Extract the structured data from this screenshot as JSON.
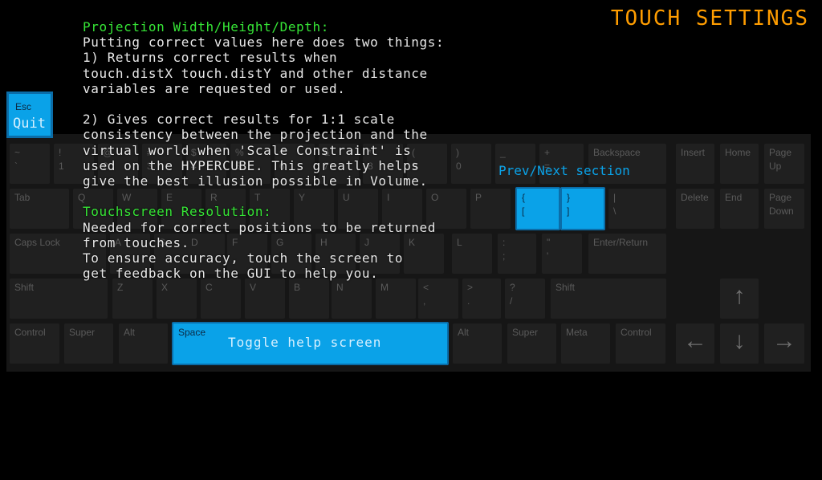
{
  "title": "TOUCH SETTINGS",
  "esc_key": {
    "label": "Esc",
    "hint": "Quit"
  },
  "nav_hint": "Prev/Next section",
  "space_key": {
    "label": "Space",
    "hint": "Toggle help screen"
  },
  "help": {
    "heading1": "Projection Width/Height/Depth:",
    "body1": "Putting correct values here does two things:\n1) Returns correct results when\ntouch.distX touch.distY and other distance\nvariables are requested or used.\n\n2) Gives correct results for 1:1 scale\nconsistency between the projection and the\nvirtual world when 'Scale Constraint' is\nused on the HYPERCUBE. This greatly helps\ngive the best illusion possible in Volume.\n",
    "heading2": "Touchscreen Resolution:",
    "body2": "Needed for correct positions to be returned\nfrom touches.\nTo ensure accuracy, touch the screen to\nget feedback on the GUI to help you."
  },
  "keys": {
    "backquote": "~\n`",
    "d1": "!\n1",
    "d2": "@\n2",
    "d3": "#\n3",
    "d4": "$\n4",
    "d5": "%\n5",
    "d6": "^\n6",
    "d7": "&\n7",
    "d8": "*\n8",
    "d9": "(\n9",
    "d0": ")\n0",
    "minus": "_\n-",
    "plus": "+\n=",
    "backspace": "Backspace",
    "insert": "Insert",
    "home": "Home",
    "pageup": "Page\nUp",
    "tab": "Tab",
    "q": "Q",
    "w": "W",
    "e": "E",
    "r": "R",
    "t": "T",
    "y": "Y",
    "u": "U",
    "i": "I",
    "o": "O",
    "p": "P",
    "lbracket": "{\n[",
    "rbracket": "}\n]",
    "backslash": "|\n\\",
    "delete": "Delete",
    "end": "End",
    "pagedown": "Page\nDown",
    "capslock": "Caps Lock",
    "a": "A",
    "s": "S",
    "d": "D",
    "f": "F",
    "g": "G",
    "h": "H",
    "j": "J",
    "k": "K",
    "l": "L",
    "semicolon": ":\n;",
    "quote": "\"\n'",
    "enter": "Enter/Return",
    "lshift": "Shift",
    "z": "Z",
    "x": "X",
    "c": "C",
    "v": "V",
    "b": "B",
    "n": "N",
    "m": "M",
    "comma": "<\n,",
    "period": ">\n.",
    "slash": "?\n/",
    "rshift": "Shift",
    "up": "↑",
    "lcontrol": "Control",
    "lsuper": "Super",
    "lalt": "Alt",
    "ralt": "Alt",
    "rsuper": "Super",
    "meta": "Meta",
    "rcontrol": "Control",
    "left": "←",
    "down": "↓",
    "right": "→"
  }
}
